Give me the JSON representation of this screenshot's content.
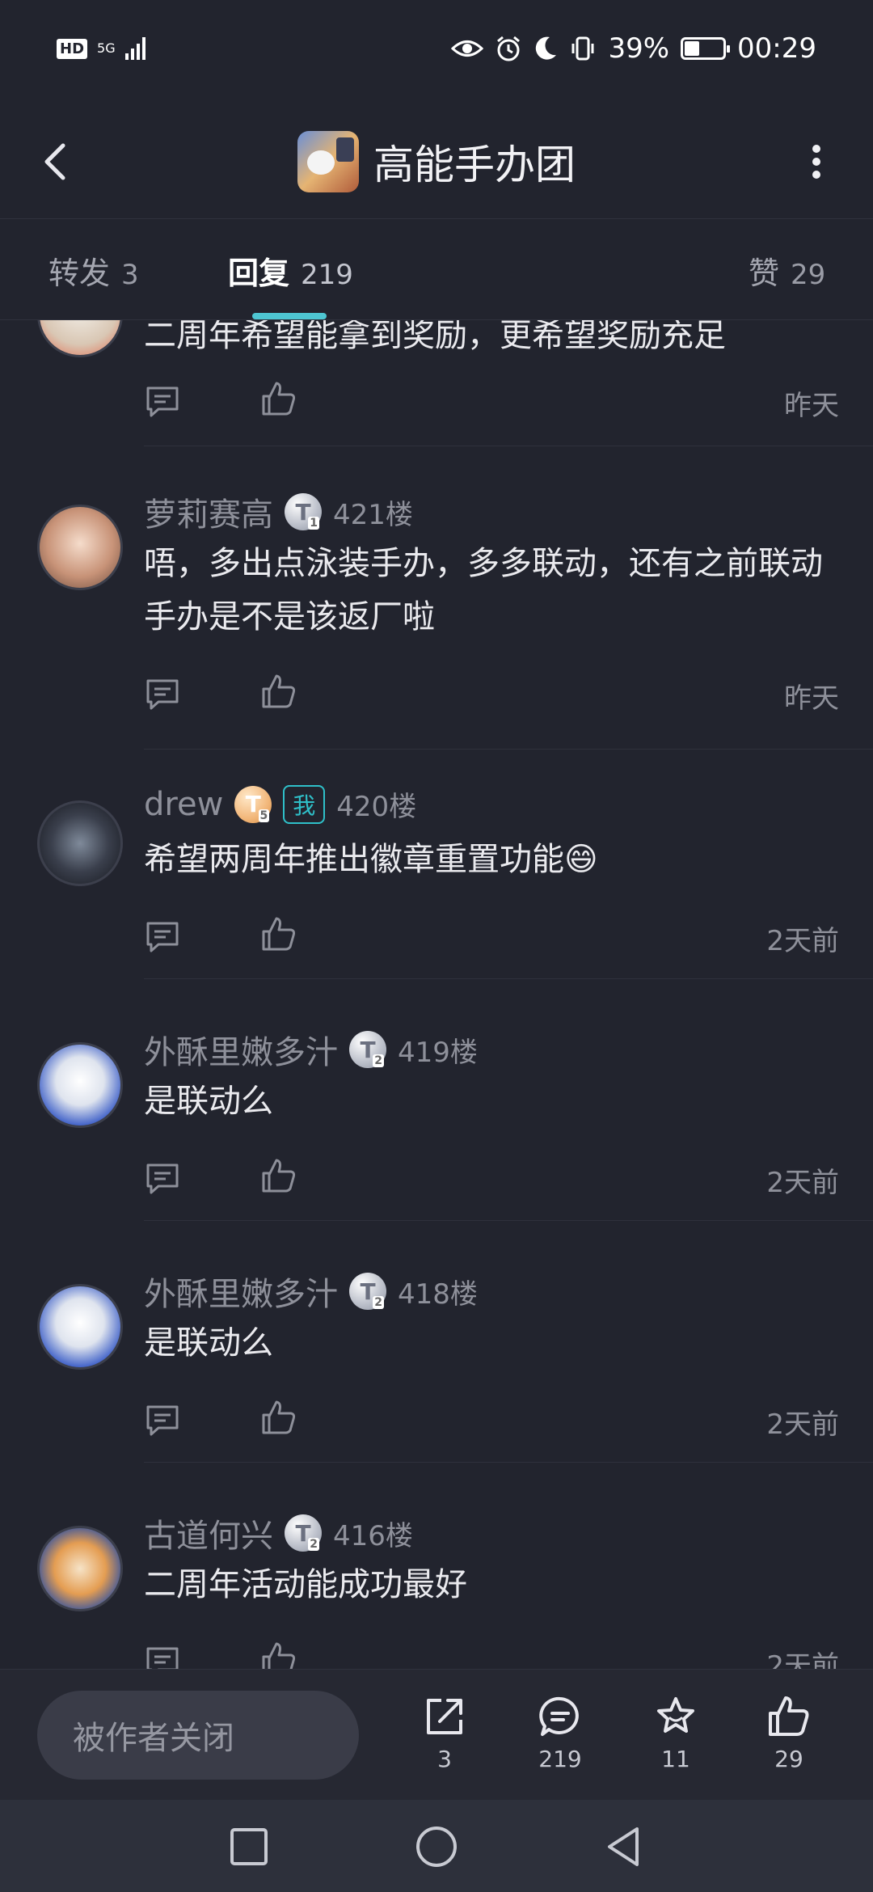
{
  "status_bar": {
    "hd_label": "HD",
    "network": "5G",
    "battery_percent": "39%",
    "battery_level": 0.39,
    "time": "00:29"
  },
  "header": {
    "title": "高能手办团"
  },
  "tabs": [
    {
      "label": "转发",
      "count": "3"
    },
    {
      "label": "回复",
      "count": "219"
    },
    {
      "label": "赞",
      "count": "29"
    }
  ],
  "replies": [
    {
      "content": "二周年希望能拿到奖励，更希望奖励充足",
      "time": "昨天"
    },
    {
      "username": "萝莉赛高",
      "badge": "T",
      "badge_level": "1",
      "floor": "421楼",
      "content": "唔，多出点泳装手办，多多联动，还有之前联动手办是不是该返厂啦",
      "time": "昨天"
    },
    {
      "username": "drew",
      "badge": "T",
      "badge_level": "5",
      "me_tag": "我",
      "floor": "420楼",
      "content": "希望两周年推出徽章重置功能😄",
      "time": "2天前"
    },
    {
      "username": "外酥里嫩多汁",
      "badge": "T",
      "badge_level": "2",
      "floor": "419楼",
      "content": "是联动么",
      "time": "2天前"
    },
    {
      "username": "外酥里嫩多汁",
      "badge": "T",
      "badge_level": "2",
      "floor": "418楼",
      "content": "是联动么",
      "time": "2天前"
    },
    {
      "username": "古道何兴",
      "badge": "T",
      "badge_level": "2",
      "floor": "416楼",
      "content": "二周年活动能成功最好",
      "time": "2天前"
    }
  ],
  "bottom_bar": {
    "input_placeholder": "被作者关闭",
    "share_count": "3",
    "comment_count": "219",
    "favorite_count": "11",
    "like_count": "29"
  },
  "colors": {
    "background": "#22242e",
    "accent": "#4ec6d2",
    "text_secondary": "#8e909a"
  }
}
